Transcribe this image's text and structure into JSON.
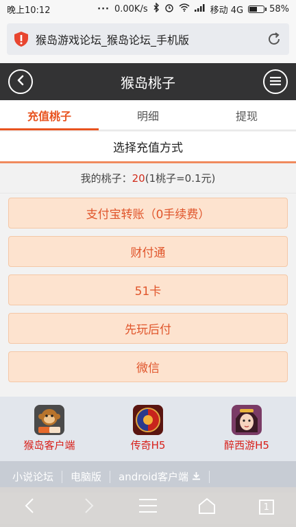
{
  "status_bar": {
    "time": "晚上10:12",
    "speed": "0.00K/s",
    "carrier": "移动 4G",
    "battery_text": "58%",
    "battery_level": 0.58
  },
  "url_bar": {
    "title": "猴岛游戏论坛_猴岛论坛_手机版"
  },
  "header": {
    "title": "猴岛桃子"
  },
  "tabs": [
    {
      "label": "充值桃子",
      "active": true
    },
    {
      "label": "明细",
      "active": false
    },
    {
      "label": "提现",
      "active": false
    }
  ],
  "section_title": "选择充值方式",
  "balance": {
    "prefix": "我的桃子：",
    "amount": "20",
    "suffix": "(1桃子=0.1元)"
  },
  "payment_methods": [
    "支付宝转账（0手续费）",
    "财付通",
    "51卡",
    "先玩后付",
    "微信"
  ],
  "apps": [
    {
      "label": "猴岛客户端",
      "icon": "houdao-logo-icon"
    },
    {
      "label": "传奇H5",
      "icon": "chuanqi-game-icon"
    },
    {
      "label": "醉西游H5",
      "icon": "zuixiyou-game-icon"
    }
  ],
  "footer_links": [
    "小说论坛",
    "电脑版",
    "android客户端"
  ],
  "nav": {
    "tab_count": "1"
  },
  "colors": {
    "accent": "#e8531f",
    "header_bg": "#333334",
    "button_bg": "#fde3cf",
    "app_label": "#d8201a"
  }
}
